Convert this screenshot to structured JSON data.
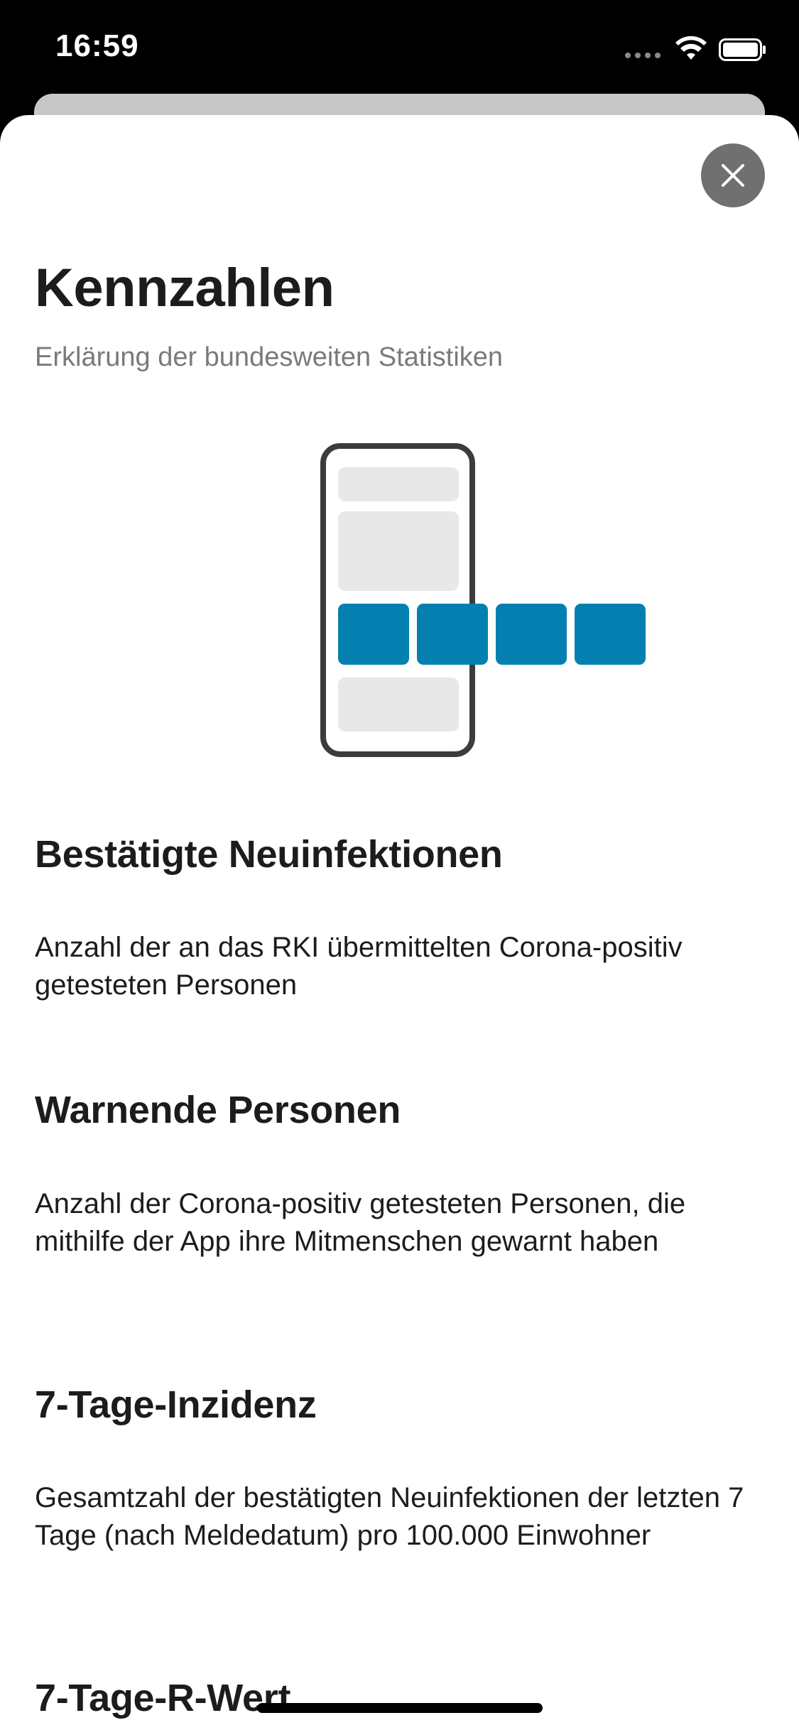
{
  "status_bar": {
    "time": "16:59"
  },
  "close_button": {
    "icon": "close-icon"
  },
  "header": {
    "title": "Kennzahlen",
    "subtitle": "Erklärung der bundesweiten Statistiken"
  },
  "illustration": {
    "icon": "phone-with-cards-icon",
    "colors": {
      "accent": "#0380b0",
      "placeholder": "#e8e8e8",
      "frame": "#3c3c3c"
    }
  },
  "sections": [
    {
      "title": "Bestätigte Neuinfektionen",
      "body": "Anzahl der an das RKI übermittelten Corona-positiv getesteten Personen"
    },
    {
      "title": "Warnende Personen",
      "body": "Anzahl der Corona-positiv getesteten Personen, die mithilfe der App ihre Mitmenschen gewarnt haben"
    },
    {
      "title": "7-Tage-Inzidenz",
      "body": "Gesamtzahl der bestätigten Neuinfektionen der letzten 7 Tage (nach Meldedatum) pro 100.000 Einwohner"
    },
    {
      "title": "7-Tage-R-Wert"
    }
  ]
}
